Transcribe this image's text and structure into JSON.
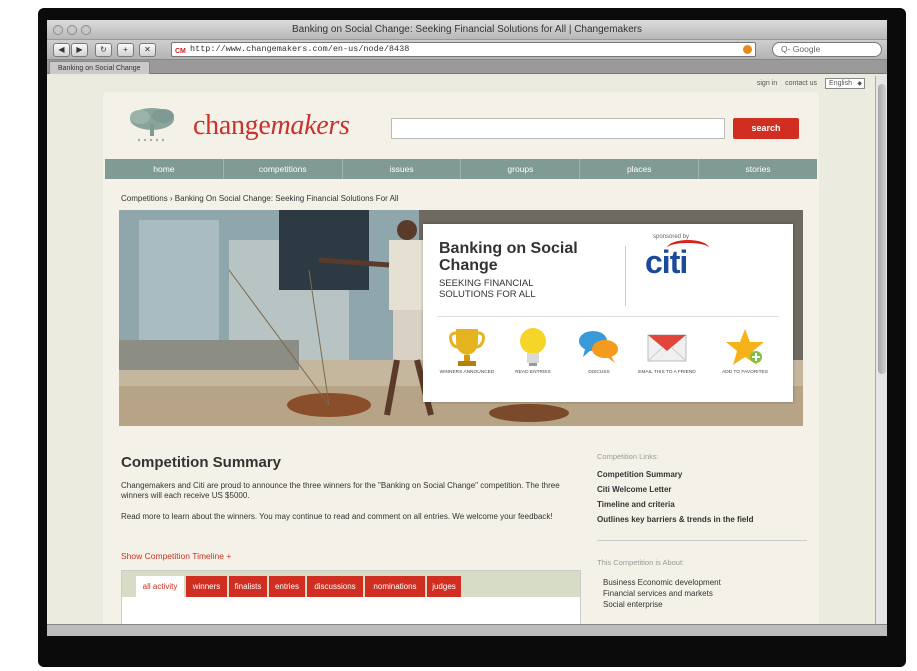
{
  "window": {
    "title": "Banking on Social Change: Seeking Financial Solutions for All | Changemakers",
    "url": "http://www.changemakers.com/en-us/node/8438",
    "search_placeholder": "Q- Google",
    "tab": "Banking on Social Change"
  },
  "utility": {
    "signin": "sign in",
    "contact": "contact us",
    "language": "English"
  },
  "site": {
    "logo_plain": "change",
    "logo_italic": "makers",
    "search_button": "search"
  },
  "nav": [
    "home",
    "competitions",
    "issues",
    "groups",
    "places",
    "stories"
  ],
  "breadcrumb": "Competitions › Banking On Social Change: Seeking Financial Solutions For All",
  "hero": {
    "title": "Banking on Social Change",
    "subtitle": "SEEKING FINANCIAL SOLUTIONS FOR ALL",
    "sponsor_label": "sponsored by",
    "sponsor": "citi",
    "actions": [
      {
        "label": "WINNERS ANNOUNCED",
        "icon": "trophy-icon"
      },
      {
        "label": "READ ENTRIES",
        "icon": "lightbulb-icon"
      },
      {
        "label": "DISCUSS",
        "icon": "speech-bubbles-icon"
      },
      {
        "label": "EMAIL THIS TO A FRIEND",
        "icon": "envelope-icon"
      },
      {
        "label": "ADD TO FAVORITES",
        "icon": "star-icon"
      }
    ]
  },
  "summary": {
    "title": "Competition Summary",
    "p1": "Changemakers and Citi are proud to announce the three winners for the \"Banking on Social Change\" competition. The three winners will each receive US $5000.",
    "p2": "Read more to learn about the winners. You may continue to read and comment on all entries. We welcome your feedback!",
    "timeline_link": "Show Competition Timeline +"
  },
  "content_tabs": [
    "all activity",
    "winners",
    "finalists",
    "entries",
    "discussions",
    "nominations",
    "judges"
  ],
  "aside": {
    "links_heading": "Competition Links:",
    "links": [
      "Competition Summary",
      "Citi Welcome Letter",
      "Timeline and criteria",
      "Outlines key barriers & trends in the field"
    ],
    "about_heading": "This Competition is About:",
    "about": [
      "Business    Economic development",
      "Financial services and markets",
      "Social enterprise"
    ]
  }
}
